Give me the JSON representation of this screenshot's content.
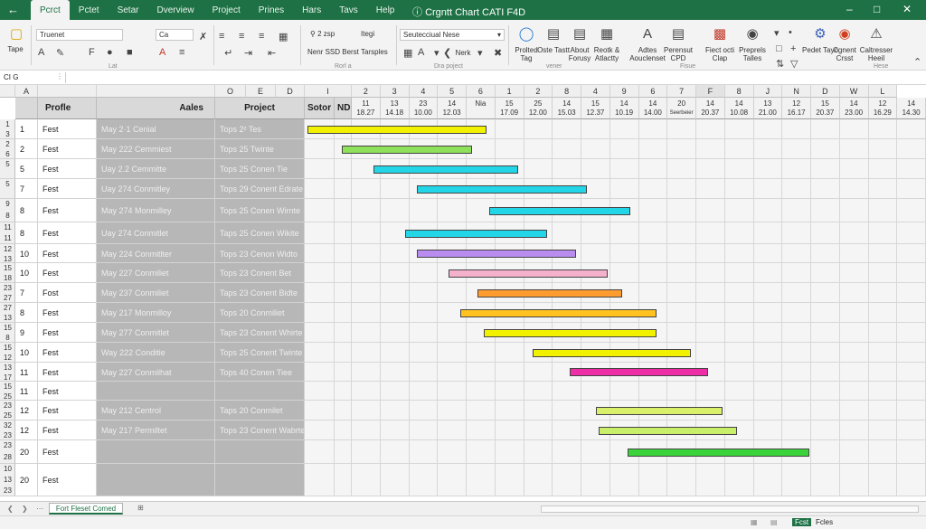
{
  "title_bar": {
    "back_icon": "arrow-left-icon",
    "tabs": [
      "Pcrct",
      "Pctet",
      "Setar",
      "Dverview",
      "Project",
      "Prines",
      "Hars",
      "Tavs",
      "Help"
    ],
    "active_tab": 0,
    "app_title": "Crgntt Chart CATI F4D",
    "help_icon": "help-icon"
  },
  "ribbon": {
    "paste_label": "Tape",
    "font_name": "Truenet",
    "font_size": "Ca",
    "zoom_box": "2 zsp",
    "zoom_tail": "Itegi",
    "style_box": "Seutecciual Nese",
    "style_label": "Nerk",
    "new_templates": "Nenr SSD Berst Tarsples",
    "group_labels": [
      "Lat",
      "Rorl a",
      "Dra poject",
      "vener",
      "Fisue",
      "Hese"
    ],
    "buttons": [
      {
        "label": "Prolted Tag",
        "icon": "tag-icon"
      },
      {
        "label": "Oste Tastt",
        "icon": "calendar-icon"
      },
      {
        "label": "About Forusy",
        "icon": "document-icon"
      },
      {
        "label": "Reotk & Atlactty",
        "icon": "report-icon"
      },
      {
        "label": "Adtes Aouclenset",
        "icon": "text-icon"
      },
      {
        "label": "Perensut CPD",
        "icon": "page-icon"
      },
      {
        "label": "Fiect octi Clap",
        "icon": "chart-icon"
      },
      {
        "label": "Preprels Talles",
        "icon": "pin-icon"
      },
      {
        "label": "Pedet Tayo",
        "icon": "gear-icon"
      },
      {
        "label": "Cgnent Crsst",
        "icon": "globe-icon"
      },
      {
        "label": "Caltresser Heeil",
        "icon": "warning-icon"
      }
    ]
  },
  "formula_bar": {
    "name_box": "CI G"
  },
  "columns": {
    "letters": [
      "A",
      "",
      "",
      "O",
      "E",
      "D",
      "I",
      "",
      "2",
      "3",
      "4",
      "5",
      "6",
      "1",
      "2",
      "8",
      "4",
      "9",
      "6",
      "7",
      "F",
      "8",
      "J",
      "N",
      "D",
      "W",
      "L"
    ],
    "headers": [
      "Profle",
      "Aales",
      "Project",
      "Sotor",
      "ND"
    ],
    "dates": [
      {
        "top": "11",
        "bottom": "18.27"
      },
      {
        "top": "13",
        "bottom": "14.18"
      },
      {
        "top": "23",
        "bottom": "10.00"
      },
      {
        "top": "14",
        "bottom": "12.03"
      },
      {
        "top": "",
        "bottom": "Nia"
      },
      {
        "top": "15",
        "bottom": "17.09"
      },
      {
        "top": "25",
        "bottom": "12.00"
      },
      {
        "top": "14",
        "bottom": "15.03"
      },
      {
        "top": "15",
        "bottom": "12.37"
      },
      {
        "top": "14",
        "bottom": "10.19"
      },
      {
        "top": "14",
        "bottom": "14.00"
      },
      {
        "top": "20",
        "bottom": "Seerbeier"
      },
      {
        "top": "14",
        "bottom": "20.37"
      },
      {
        "top": "14",
        "bottom": "10.08"
      },
      {
        "top": "13",
        "bottom": "21.00"
      },
      {
        "top": "12",
        "bottom": "16.17"
      },
      {
        "top": "15",
        "bottom": "20.37"
      },
      {
        "top": "14",
        "bottom": "23.00"
      },
      {
        "top": "12",
        "bottom": "16.29"
      },
      {
        "top": "14",
        "bottom": "14.30"
      }
    ]
  },
  "rows": [
    {
      "nums": [
        "1",
        "3"
      ],
      "id": "1",
      "profile": "Fest",
      "sales": "May 2·1 Cenial",
      "project": "Tops 2² Tes"
    },
    {
      "nums": [
        "2",
        "6"
      ],
      "id": "2",
      "profile": "Fest",
      "sales": "May 222 Cemmiest",
      "project": "Tops 25 Twinte"
    },
    {
      "nums": [
        "5",
        ""
      ],
      "id": "5",
      "profile": "Fest",
      "sales": "Uay 2.2 Cemmitte",
      "project": "Tops 25 Conen Tie"
    },
    {
      "nums": [
        "5",
        ""
      ],
      "id": "7",
      "profile": "Fest",
      "sales": "Uay 274 Conmitley",
      "project": "Tops 29 Conent Edrate"
    },
    {
      "nums": [
        "9",
        "8"
      ],
      "id": "8",
      "profile": "Fest",
      "sales": "May 274 Monmilley",
      "project": "Tops 25 Conen Wirnte"
    },
    {
      "nums": [
        "11",
        "11"
      ],
      "id": "8",
      "profile": "Fest",
      "sales": "Uay 274 Conmitlet",
      "project": "Taps 25 Conen Wikite"
    },
    {
      "nums": [
        "12",
        "13"
      ],
      "id": "10",
      "profile": "Fest",
      "sales": "May 224 Conmitlter",
      "project": "Tops 23 Cenon Widto"
    },
    {
      "nums": [
        "15",
        "18"
      ],
      "id": "10",
      "profile": "Fest",
      "sales": "May 227 Conmiliet",
      "project": "Tops 23 Conent Bet"
    },
    {
      "nums": [
        "23",
        "27"
      ],
      "id": "7",
      "profile": "Fost",
      "sales": "May 237 Conmiliet",
      "project": "Taps 23 Conent Bidte"
    },
    {
      "nums": [
        "27",
        "13"
      ],
      "id": "8",
      "profile": "Fest",
      "sales": "May 217 Monmilloy",
      "project": "Tops 20 Conmiliet"
    },
    {
      "nums": [
        "15",
        "8"
      ],
      "id": "9",
      "profile": "Fest",
      "sales": "May 277 Conmitlet",
      "project": "Taps 23 Conent Whirte"
    },
    {
      "nums": [
        "15",
        "12"
      ],
      "id": "10",
      "profile": "Fest",
      "sales": "Way 222 Conditie",
      "project": "Tops 25 Conent Twinte"
    },
    {
      "nums": [
        "13",
        "17"
      ],
      "id": "11",
      "profile": "Fest",
      "sales": "May 227 Conmilhat",
      "project": "Tops 40 Conen Tiee"
    },
    {
      "nums": [
        "15",
        "25"
      ],
      "id": "11",
      "profile": "Fest",
      "sales": "",
      "project": ""
    },
    {
      "nums": [
        "23",
        "25"
      ],
      "id": "12",
      "profile": "Fest",
      "sales": "May 212 Centrol",
      "project": "Taps 20 Conmilet"
    },
    {
      "nums": [
        "32",
        "23"
      ],
      "id": "12",
      "profile": "Fest",
      "sales": "May 217 Permiltet",
      "project": "Tops 23 Conent Wabrte"
    },
    {
      "nums": [
        "23",
        "28"
      ],
      "id": "20",
      "profile": "Fest",
      "sales": "",
      "project": ""
    },
    {
      "nums": [
        "10",
        "13",
        "23"
      ],
      "id": "20",
      "profile": "Fest",
      "sales": "",
      "project": ""
    }
  ],
  "gantt": {
    "start_col": 0,
    "tasks": [
      {
        "row": 0,
        "start": 0.0,
        "end": 6.2,
        "color": "#f2f200"
      },
      {
        "row": 1,
        "start": 1.2,
        "end": 5.7,
        "color": "#8fe05a"
      },
      {
        "row": 2,
        "start": 2.3,
        "end": 7.3,
        "color": "#22d6e8"
      },
      {
        "row": 3,
        "start": 3.8,
        "end": 9.7,
        "color": "#22d6e8"
      },
      {
        "row": 4,
        "start": 6.3,
        "end": 11.2,
        "color": "#22d6e8"
      },
      {
        "row": 5,
        "start": 3.4,
        "end": 8.3,
        "color": "#22d6e8"
      },
      {
        "row": 6,
        "start": 3.8,
        "end": 9.3,
        "color": "#b98cf0"
      },
      {
        "row": 7,
        "start": 4.9,
        "end": 10.4,
        "color": "#f5b0cc"
      },
      {
        "row": 8,
        "start": 5.9,
        "end": 10.9,
        "color": "#ff9c30"
      },
      {
        "row": 9,
        "start": 5.3,
        "end": 12.1,
        "color": "#ffc21e"
      },
      {
        "row": 10,
        "start": 6.1,
        "end": 12.1,
        "color": "#f2f200"
      },
      {
        "row": 11,
        "start": 7.8,
        "end": 13.3,
        "color": "#f2f200"
      },
      {
        "row": 12,
        "start": 9.1,
        "end": 13.9,
        "color": "#ee2ea6"
      },
      {
        "row": 14,
        "start": 10.0,
        "end": 14.4,
        "color": "#d8f06a"
      },
      {
        "row": 15,
        "start": 10.1,
        "end": 14.9,
        "color": "#c8ee6a"
      },
      {
        "row": 16,
        "start": 11.1,
        "end": 17.4,
        "color": "#3ad33a"
      }
    ]
  },
  "sheet_tabs": {
    "active": "Fort Fleset Comed"
  },
  "status_bar": {
    "mode": "Fcst",
    "text": "Fcles"
  }
}
